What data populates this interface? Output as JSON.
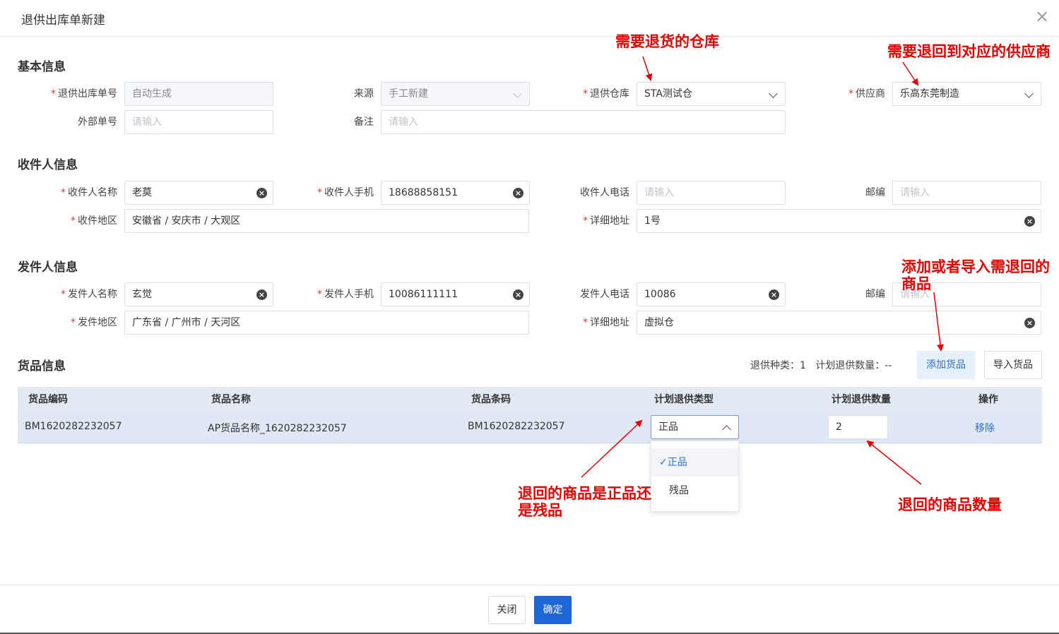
{
  "dialog": {
    "title": "退供出库单新建",
    "close": "×"
  },
  "sections": {
    "basic": "基本信息",
    "receiver": "收件人信息",
    "sender": "发件人信息",
    "goods": "货品信息"
  },
  "basic": {
    "order_no": {
      "label": "退供出库单号",
      "value": "自动生成"
    },
    "source": {
      "label": "来源",
      "value": "手工新建"
    },
    "warehouse": {
      "label": "退供仓库",
      "value": "STA测试仓"
    },
    "supplier": {
      "label": "供应商",
      "value": "乐高东莞制造"
    },
    "external_no": {
      "label": "外部单号",
      "placeholder": "请输入"
    },
    "remark": {
      "label": "备注",
      "placeholder": "请输入"
    }
  },
  "receiver": {
    "name": {
      "label": "收件人名称",
      "value": "老莫"
    },
    "mobile": {
      "label": "收件人手机",
      "value": "18688858151"
    },
    "phone": {
      "label": "收件人电话",
      "placeholder": "请输入"
    },
    "zip": {
      "label": "邮编",
      "placeholder": "请输入"
    },
    "region": {
      "label": "收件地区",
      "value": "安徽省 / 安庆市 / 大观区"
    },
    "address": {
      "label": "详细地址",
      "value": "1号"
    }
  },
  "sender": {
    "name": {
      "label": "发件人名称",
      "value": "玄觉"
    },
    "mobile": {
      "label": "发件人手机",
      "value": "10086111111"
    },
    "phone": {
      "label": "发件人电话",
      "value": "10086"
    },
    "zip": {
      "label": "邮编",
      "placeholder": "请输入"
    },
    "region": {
      "label": "发件地区",
      "value": "广东省 / 广州市 / 天河区"
    },
    "address": {
      "label": "详细地址",
      "value": "虚拟仓"
    }
  },
  "goods": {
    "summary": "退供种类：1   计划退供数量：--",
    "add_button": "添加货品",
    "import_button": "导入货品",
    "columns": [
      "货品编码",
      "货品名称",
      "货品条码",
      "计划退供类型",
      "计划退供数量",
      "操作"
    ],
    "row": {
      "code": "BM1620282232057",
      "name": "AP货品名称_1620282232057",
      "barcode": "BM1620282232057",
      "type": "正品",
      "quantity": "2",
      "action": "移除"
    },
    "type_options": [
      "正品",
      "残品"
    ],
    "type_selected_mark": "✓"
  },
  "annotations": {
    "warehouse": "需要退货的仓库",
    "supplier": "需要退回到对应的供应商",
    "add_goods": "添加或者导入需退回的商品",
    "type": "退回的商品是正品还是残品",
    "quantity": "退回的商品数量"
  },
  "footer": {
    "close_button": "关闭",
    "confirm_button": "确定"
  },
  "colors": {
    "primary": "#1c66d6",
    "annotation": "#e60000",
    "required": "#e53935"
  }
}
